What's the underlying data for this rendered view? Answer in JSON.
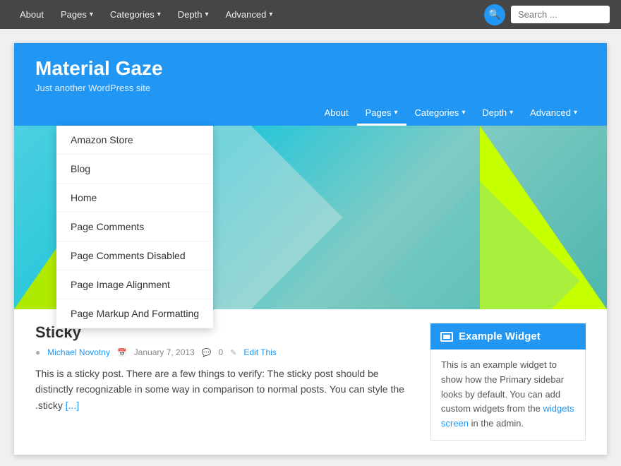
{
  "admin_bar": {
    "nav_items": [
      {
        "label": "About",
        "has_dropdown": false
      },
      {
        "label": "Pages",
        "has_dropdown": true
      },
      {
        "label": "Categories",
        "has_dropdown": true
      },
      {
        "label": "Depth",
        "has_dropdown": true
      },
      {
        "label": "Advanced",
        "has_dropdown": true
      }
    ],
    "search_placeholder": "Search ..."
  },
  "site": {
    "title": "Material Gaze",
    "tagline": "Just another WordPress site"
  },
  "site_nav": {
    "items": [
      {
        "label": "About",
        "has_dropdown": false
      },
      {
        "label": "Pages",
        "has_dropdown": true,
        "active": true
      },
      {
        "label": "Categories",
        "has_dropdown": true
      },
      {
        "label": "Depth",
        "has_dropdown": true
      },
      {
        "label": "Advanced",
        "has_dropdown": true
      }
    ]
  },
  "pages_dropdown": {
    "items": [
      "Amazon Store",
      "Blog",
      "Home",
      "Page Comments",
      "Page Comments Disabled",
      "Page Image Alignment",
      "Page Markup And Formatting"
    ]
  },
  "post": {
    "title": "Sticky",
    "meta_author": "Michael Novotny",
    "meta_date": "January 7, 2013",
    "meta_comments": "0",
    "meta_edit": "Edit This",
    "body": "This is a sticky post. There are a few things to verify: The sticky post should be distinctly recognizable in some way in comparison to normal posts. You can style the .sticky",
    "more_link": "[...]"
  },
  "widget": {
    "title": "Example Widget",
    "body": "This is an example widget to show how the Primary sidebar looks by default. You can add custom widgets from the",
    "link_text": "widgets screen",
    "link_suffix": " in the admin."
  },
  "icons": {
    "search": "🔍",
    "chevron": "▾",
    "person": "👤",
    "calendar": "📅",
    "comment": "💬",
    "pencil": "✏",
    "widget": "▦"
  }
}
